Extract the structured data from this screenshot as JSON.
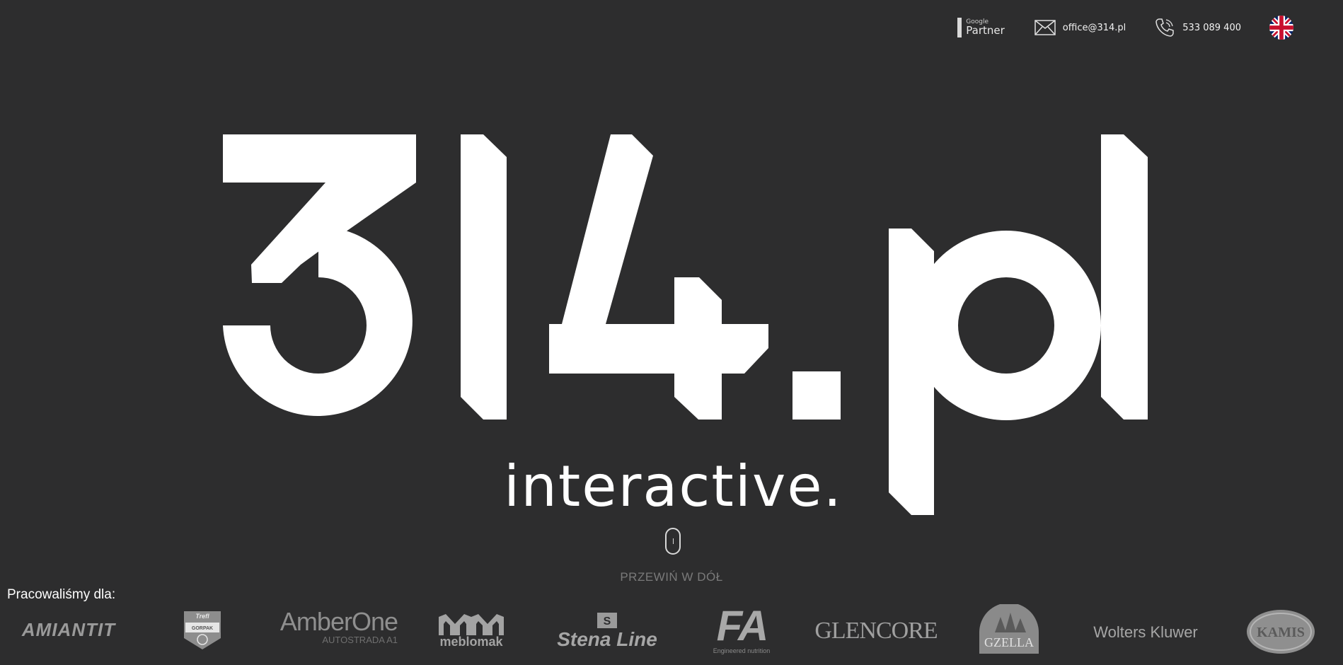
{
  "header": {
    "google_partner_small": "Google",
    "google_partner_big": "Partner",
    "email": "office@314.pl",
    "phone": "533 089 400",
    "language_icon": "uk-flag-icon"
  },
  "hero": {
    "logo_text": "314.pl",
    "tagline": "interactive.",
    "scroll_hint": "PRZEWIŃ W DÓŁ"
  },
  "clients": {
    "label": "Pracowaliśmy dla:",
    "logos": {
      "amiantit": "AMIANTIT",
      "gorpak": "GORPAK",
      "gorpak_top": "Trefl",
      "amberone_main": "AmberOne",
      "amberone_sub": "AUTOSTRADA A1",
      "meblomak": "meblomak",
      "stena_badge": "S",
      "stena": "Stena Line",
      "fa_main": "FA",
      "fa_sub": "Engineered nutrition",
      "glencore": "GLENCORE",
      "gzella": "GZELLA",
      "wolters_kluwer": "Wolters Kluwer",
      "kamis": "KAMIS"
    }
  },
  "colors": {
    "background": "#2d2d2e",
    "foreground": "#ffffff",
    "logo_gray": "#9e9e9e"
  }
}
